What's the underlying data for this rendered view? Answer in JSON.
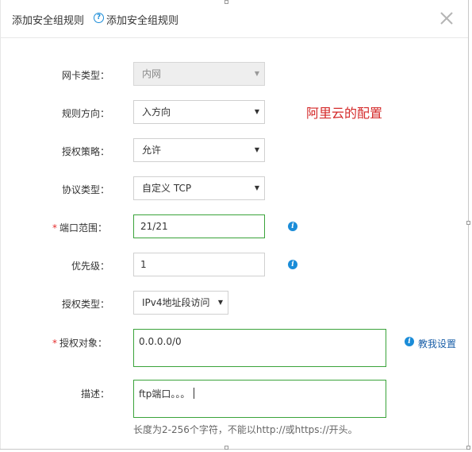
{
  "dialog": {
    "title": "添加安全组规则",
    "help_text": "添加安全组规则",
    "help_icon": "question-circle-icon",
    "close_icon": "close-icon"
  },
  "annotation": "阿里云的配置",
  "form": {
    "nic_type": {
      "label": "网卡类型：",
      "value": "内网",
      "disabled": true
    },
    "direction": {
      "label": "规则方向：",
      "value": "入方向"
    },
    "policy": {
      "label": "授权策略：",
      "value": "允许"
    },
    "protocol": {
      "label": "协议类型：",
      "value": "自定义 TCP"
    },
    "port_range": {
      "required_mark": "*",
      "label": "端口范围：",
      "value": "21/21"
    },
    "priority": {
      "label": "优先级：",
      "value": "1"
    },
    "auth_type": {
      "label": "授权类型：",
      "value": "IPv4地址段访问"
    },
    "auth_object": {
      "required_mark": "*",
      "label": "授权对象：",
      "value": "0.0.0.0/0",
      "help_link": "教我设置"
    },
    "description": {
      "label": "描述：",
      "value": "ftp端口。。。",
      "hint": "长度为2-256个字符，不能以http://或https://开头。"
    }
  },
  "colors": {
    "accent": "#1a8cd8",
    "valid_border": "#3aa33a",
    "required": "#e52e2e",
    "annotation": "#d42a2a"
  }
}
